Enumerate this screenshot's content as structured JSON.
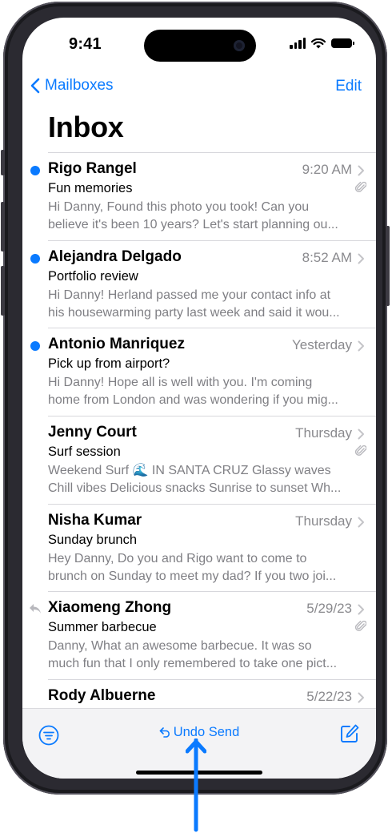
{
  "status": {
    "time": "9:41"
  },
  "nav": {
    "back_label": "Mailboxes",
    "edit_label": "Edit",
    "title": "Inbox"
  },
  "messages": [
    {
      "sender": "Rigo Rangel",
      "date": "9:20 AM",
      "subject": "Fun memories",
      "preview1": "Hi Danny, Found this photo you took! Can you",
      "preview2": "believe it's been 10 years? Let's start planning ou...",
      "unread": true,
      "attachment": true,
      "replied": false
    },
    {
      "sender": "Alejandra Delgado",
      "date": "8:52 AM",
      "subject": "Portfolio review",
      "preview1": "Hi Danny! Herland passed me your contact info at",
      "preview2": "his housewarming party last week and said it wou...",
      "unread": true,
      "attachment": false,
      "replied": false
    },
    {
      "sender": "Antonio Manriquez",
      "date": "Yesterday",
      "subject": "Pick up from airport?",
      "preview1": "Hi Danny! Hope all is well with you. I'm coming",
      "preview2": "home from London and was wondering if you mig...",
      "unread": true,
      "attachment": false,
      "replied": false
    },
    {
      "sender": "Jenny Court",
      "date": "Thursday",
      "subject": "Surf session",
      "preview1": "Weekend Surf 🌊 IN SANTA CRUZ Glassy waves",
      "preview2": "Chill vibes Delicious snacks Sunrise to sunset Wh...",
      "unread": false,
      "attachment": true,
      "replied": false
    },
    {
      "sender": "Nisha Kumar",
      "date": "Thursday",
      "subject": "Sunday brunch",
      "preview1": "Hey Danny, Do you and Rigo want to come to",
      "preview2": "brunch on Sunday to meet my dad? If you two joi...",
      "unread": false,
      "attachment": false,
      "replied": false
    },
    {
      "sender": "Xiaomeng Zhong",
      "date": "5/29/23",
      "subject": "Summer barbecue",
      "preview1": "Danny, What an awesome barbecue. It was so",
      "preview2": "much fun that I only remembered to take one pict...",
      "unread": false,
      "attachment": true,
      "replied": true
    },
    {
      "sender": "Rody Albuerne",
      "date": "5/22/23",
      "subject": "",
      "preview1": "",
      "preview2": "",
      "unread": false,
      "attachment": false,
      "replied": false
    }
  ],
  "toolbar": {
    "undo_label": "Undo Send"
  },
  "colors": {
    "accent": "#0a7aff",
    "secondary_text": "#8a8a8e",
    "toolbar_bg": "#f3f3f5"
  },
  "icons": {
    "back": "chevron-left-icon",
    "filter": "filter-icon",
    "undo": "undo-arrow-icon",
    "compose": "compose-icon",
    "callout": "up-arrow-icon"
  }
}
